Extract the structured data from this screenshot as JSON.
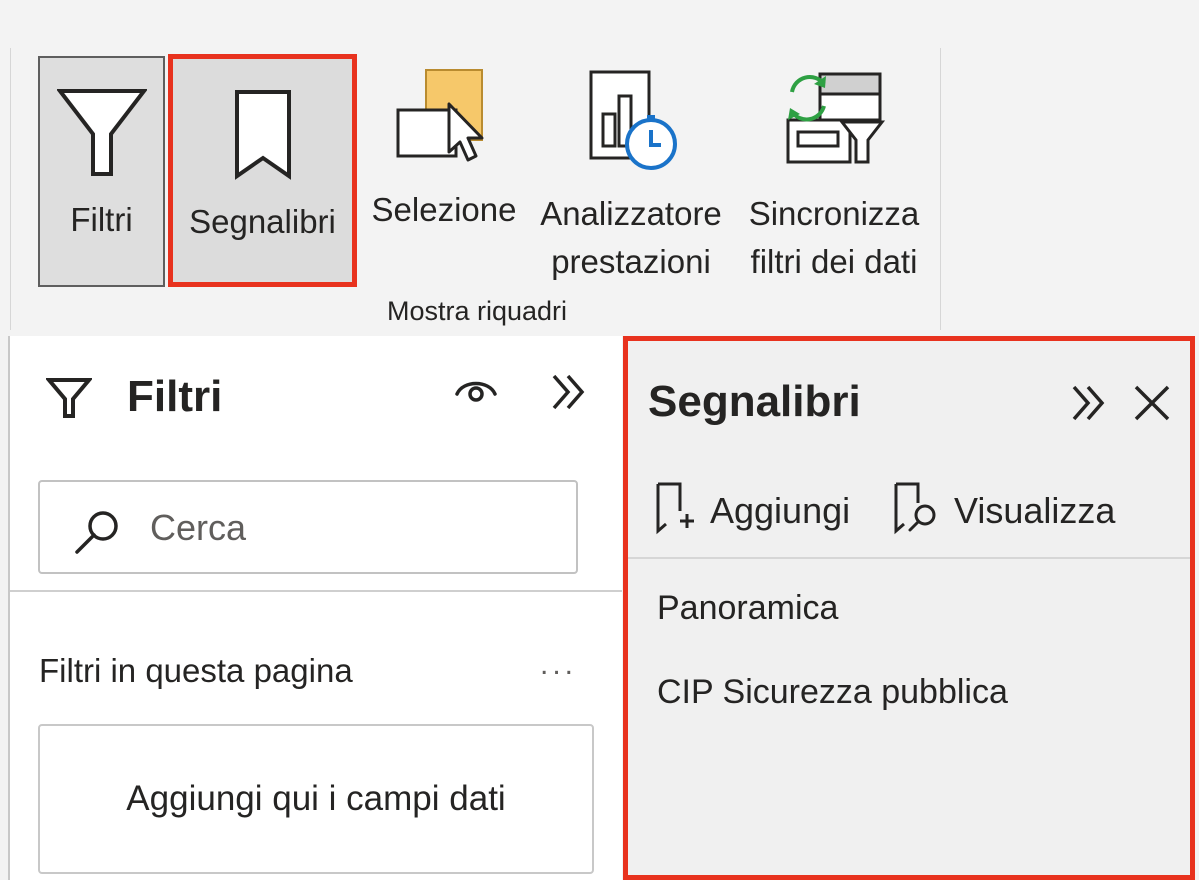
{
  "ribbon": {
    "buttons": [
      {
        "label": "Filtri"
      },
      {
        "label": "Segnalibri"
      },
      {
        "label": "Selezione"
      },
      {
        "label_line1": "Analizzatore",
        "label_line2": "prestazioni"
      },
      {
        "label_line1": "Sincronizza",
        "label_line2": "filtri dei dati"
      }
    ],
    "group_label": "Mostra riquadri"
  },
  "filter_pane": {
    "title": "Filtri",
    "search_placeholder": "Cerca",
    "section_label": "Filtri in questa pagina",
    "more_label": "...",
    "drop_hint": "Aggiungi qui i campi dati"
  },
  "bookmarks_pane": {
    "title": "Segnalibri",
    "add_label": "Aggiungi",
    "view_label": "Visualizza",
    "items": [
      {
        "label": "Panoramica"
      },
      {
        "label": "CIP Sicurezza pubblica"
      }
    ]
  },
  "colors": {
    "highlight": "#e8321e",
    "ribbon_bg": "#f3f3f3",
    "pane_bg": "#ffffff",
    "bookmarks_bg": "#f0f0f0",
    "selected_button_bg": "#dedede",
    "refresh_green": "#2ea043",
    "clock_blue": "#1a73c9"
  },
  "icons": {
    "filtri": "funnel-icon",
    "segnalibri": "bookmark-icon",
    "selezione": "selection-pane-icon",
    "analizzatore": "performance-analyzer-icon",
    "sincronizza": "sync-slicers-icon"
  }
}
